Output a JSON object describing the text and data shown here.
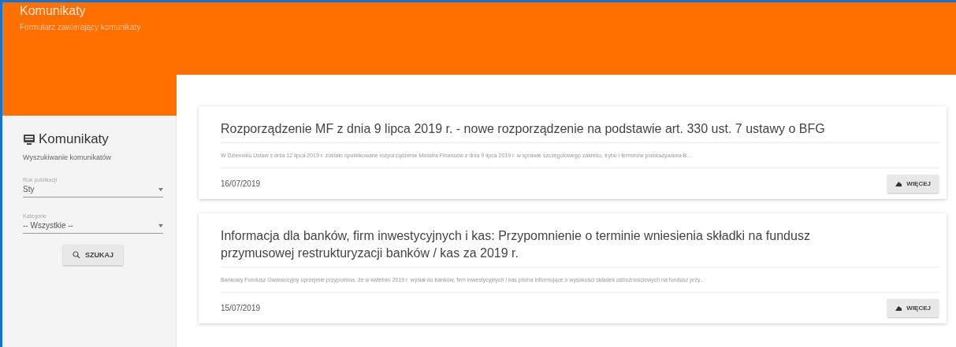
{
  "header": {
    "title": "Komunikaty",
    "subtitle": "Formularz zawierający komunikaty"
  },
  "sidebar": {
    "title": "Komunikaty",
    "subtitle": "Wyszukiwanie komunikatów",
    "fields": [
      {
        "label": "Rok publikacji",
        "value": "Sty"
      },
      {
        "label": "Kategorie",
        "value": "-- Wszystkie --"
      }
    ],
    "button": "SZUKAJ"
  },
  "cards": [
    {
      "title": "Rozporządzenie MF z dnia 9 lipca 2019 r. - nowe rozporządzenie na podstawie art. 330 ust. 7 ustawy o BFG",
      "excerpt": "W Dzienniku Ustaw z dnia 12 lipca 2019 r. zostało opublikowane rozporządzenie Ministra Finansów z dnia 9 lipca 2019 r. w sprawie szczegółowego zakresu, trybu i terminów przekazywania B...",
      "date": "16/07/2019",
      "button": "WIĘCEJ"
    },
    {
      "title": "Informacja dla banków, firm inwestycyjnych i kas: Przypomnienie o terminie wniesienia składki na fundusz przymusowej restrukturyzacji banków / kas za 2019 r.",
      "excerpt": "Bankowy Fundusz Gwarancyjny uprzejmie przypomina, że w kwietniu 2019 r. wysłał do banków, firm inwestycyjnych i kas pisma informujące o wysokości składek ostrożnościowych na fundusz przy...",
      "date": "15/07/2019",
      "button": "WIĘCEJ"
    }
  ]
}
